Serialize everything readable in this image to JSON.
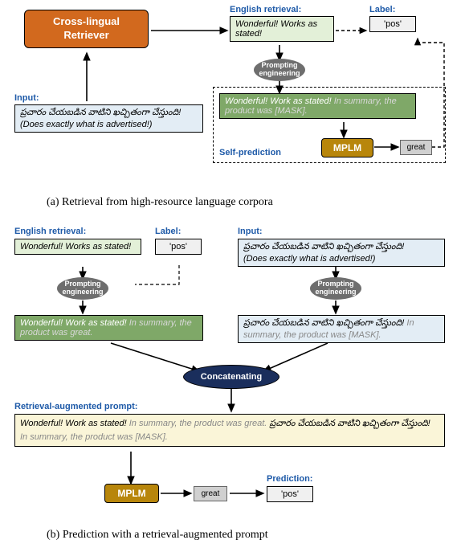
{
  "sectionA": {
    "retriever": "Cross-lingual Retriever",
    "retrieval_label": "English retrieval:",
    "retrieval_text": "Wonderful! Works as stated!",
    "label_label": "Label:",
    "label_value": "'pos'",
    "input_label": "Input:",
    "input_telugu": "ప్రచారం చేయబడిన వాటిని ఖచ్చితంగా చేస్తుంది!",
    "input_gloss": "(Does exactly what is advertised!)",
    "prompt_eng": "Prompting engineering",
    "prompt_box_prefix": "Wonderful! Work as stated!",
    "prompt_box_suffix": "In summary, the product was [MASK].",
    "self_pred": "Self-prediction",
    "mplm": "MPLM",
    "pred_word": "great",
    "caption": "(a) Retrieval from high-resource language corpora"
  },
  "sectionB": {
    "retrieval_label": "English retrieval:",
    "retrieval_text": "Wonderful! Works as stated!",
    "label_label": "Label:",
    "label_value": "'pos'",
    "input_label": "Input:",
    "input_telugu": "ప్రచారం చేయబడిన వాటిని ఖచ్చితంగా చేస్తుంది!",
    "input_gloss": "(Does exactly what is advertised!)",
    "prompt_eng": "Prompting engineering",
    "left_prompt_prefix": "Wonderful! Work as stated!",
    "left_prompt_suffix": "In summary, the product was great.",
    "right_prompt_prefix": "ప్రచారం చేయబడిన వాటిని ఖచ్చితంగా చేస్తుంది!",
    "right_prompt_suffix": "In summary, the product was [MASK].",
    "concat": "Concatenating",
    "ra_label": "Retrieval-augmented prompt:",
    "ra_text_1": "Wonderful! Work as stated!",
    "ra_text_2": "In summary, the product was great.",
    "ra_text_3": "ప్రచారం చేయబడిన వాటిని ఖచ్చితంగా చేస్తుంది!",
    "ra_text_4": "In summary, the product was [MASK].",
    "mplm": "MPLM",
    "pred_word": "great",
    "pred_label": "Prediction:",
    "pred_value": "'pos'",
    "caption": "(b) Prediction with a retrieval-augmented prompt"
  }
}
